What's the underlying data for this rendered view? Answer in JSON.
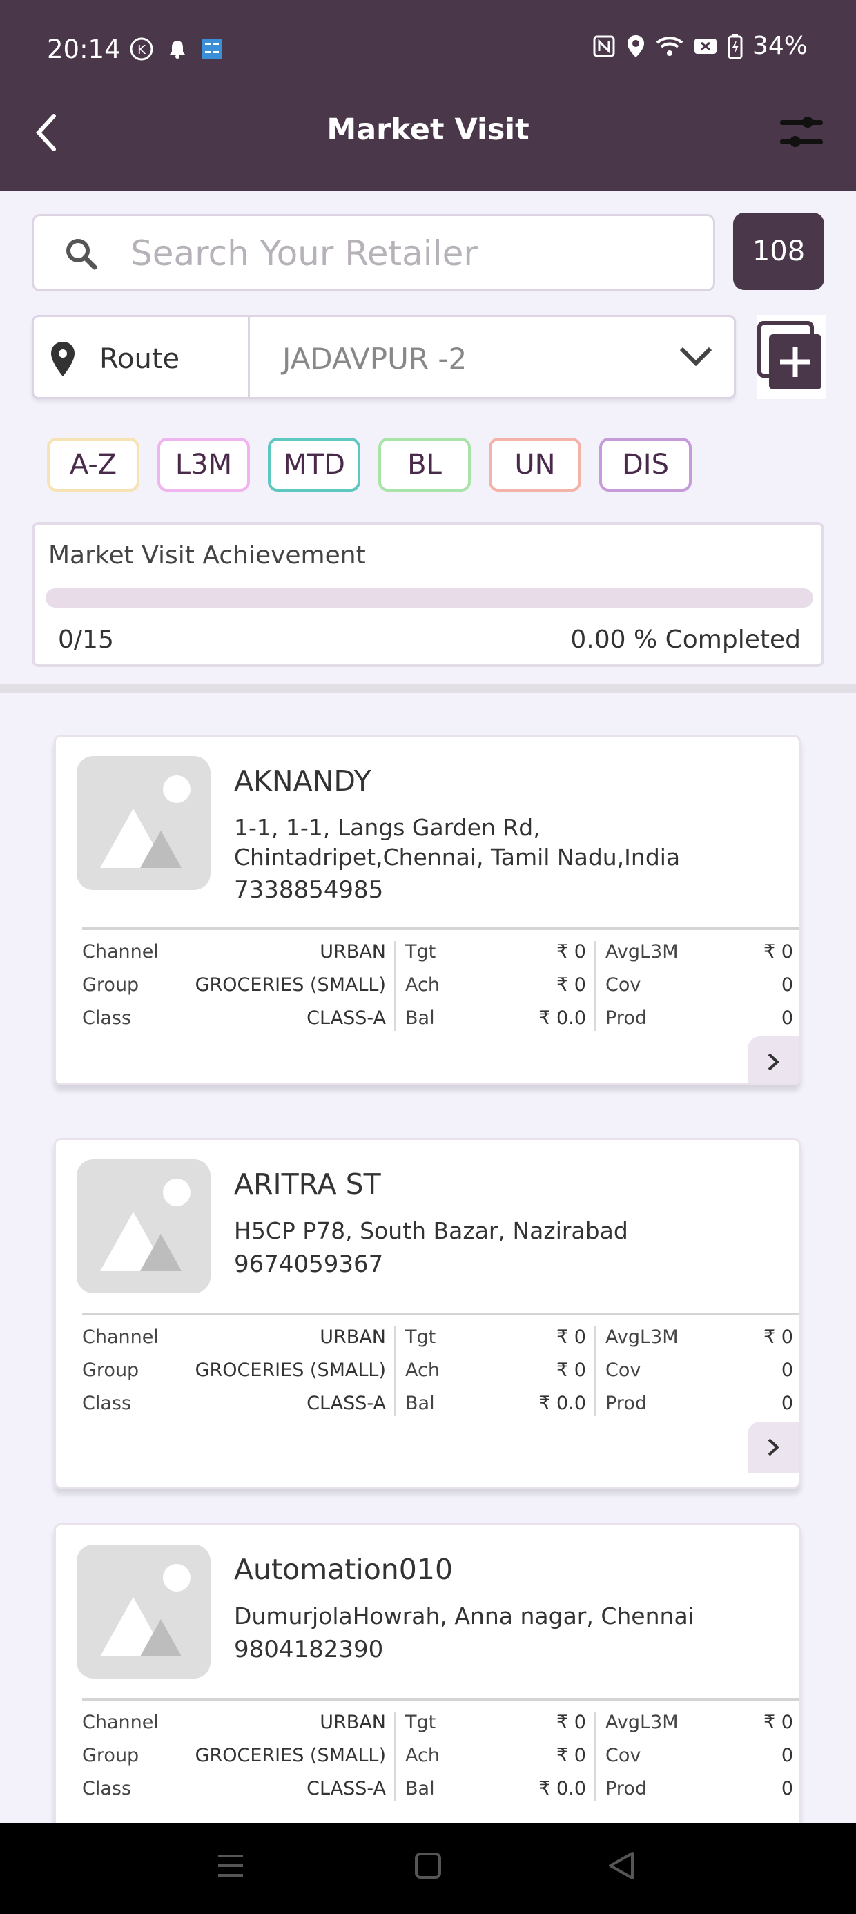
{
  "status_bar": {
    "time": "20:14",
    "battery": "34%"
  },
  "header": {
    "title": "Market Visit"
  },
  "search": {
    "placeholder": "Search Your Retailer",
    "count": "108"
  },
  "route": {
    "label": "Route",
    "value": "JADAVPUR -2"
  },
  "chips": [
    {
      "label": "A-Z",
      "color": "#f7e2b4"
    },
    {
      "label": "L3M",
      "color": "#efb5ef"
    },
    {
      "label": "MTD",
      "color": "#5ec8c0"
    },
    {
      "label": "BL",
      "color": "#a8e4a8"
    },
    {
      "label": "UN",
      "color": "#f4b3a8"
    },
    {
      "label": "DIS",
      "color": "#c79ad9"
    }
  ],
  "achievement": {
    "title": "Market Visit Achievement",
    "fraction": "0/15",
    "percent_text": "0.00 % Completed",
    "progress": 0
  },
  "labels": {
    "channel": "Channel",
    "group": "Group",
    "class": "Class",
    "tgt": "Tgt",
    "ach": "Ach",
    "bal": "Bal",
    "avgl3m": "AvgL3M",
    "cov": "Cov",
    "prod": "Prod"
  },
  "retailers": [
    {
      "name": "AKNANDY",
      "address": "1-1, 1-1, Langs Garden Rd, Chintadripet,Chennai, Tamil Nadu,India",
      "phone": "7338854985",
      "channel": "URBAN",
      "group": "GROCERIES (SMALL)",
      "class": "CLASS-A",
      "tgt": "₹ 0",
      "ach": "₹ 0",
      "bal": "₹ 0.0",
      "avgl3m": "₹ 0",
      "cov": "0",
      "prod": "0"
    },
    {
      "name": "ARITRA  ST",
      "address": "H5CP P78, South Bazar, Nazirabad",
      "phone": "9674059367",
      "channel": "URBAN",
      "group": "GROCERIES (SMALL)",
      "class": "CLASS-A",
      "tgt": "₹ 0",
      "ach": "₹ 0",
      "bal": "₹ 0.0",
      "avgl3m": "₹ 0",
      "cov": "0",
      "prod": "0"
    },
    {
      "name": "Automation010",
      "address": "DumurjolaHowrah, Anna nagar, Chennai",
      "phone": "9804182390",
      "channel": "URBAN",
      "group": "GROCERIES (SMALL)",
      "class": "CLASS-A",
      "tgt": "₹ 0",
      "ach": "₹ 0",
      "bal": "₹ 0.0",
      "avgl3m": "₹ 0",
      "cov": "0",
      "prod": "0"
    }
  ]
}
